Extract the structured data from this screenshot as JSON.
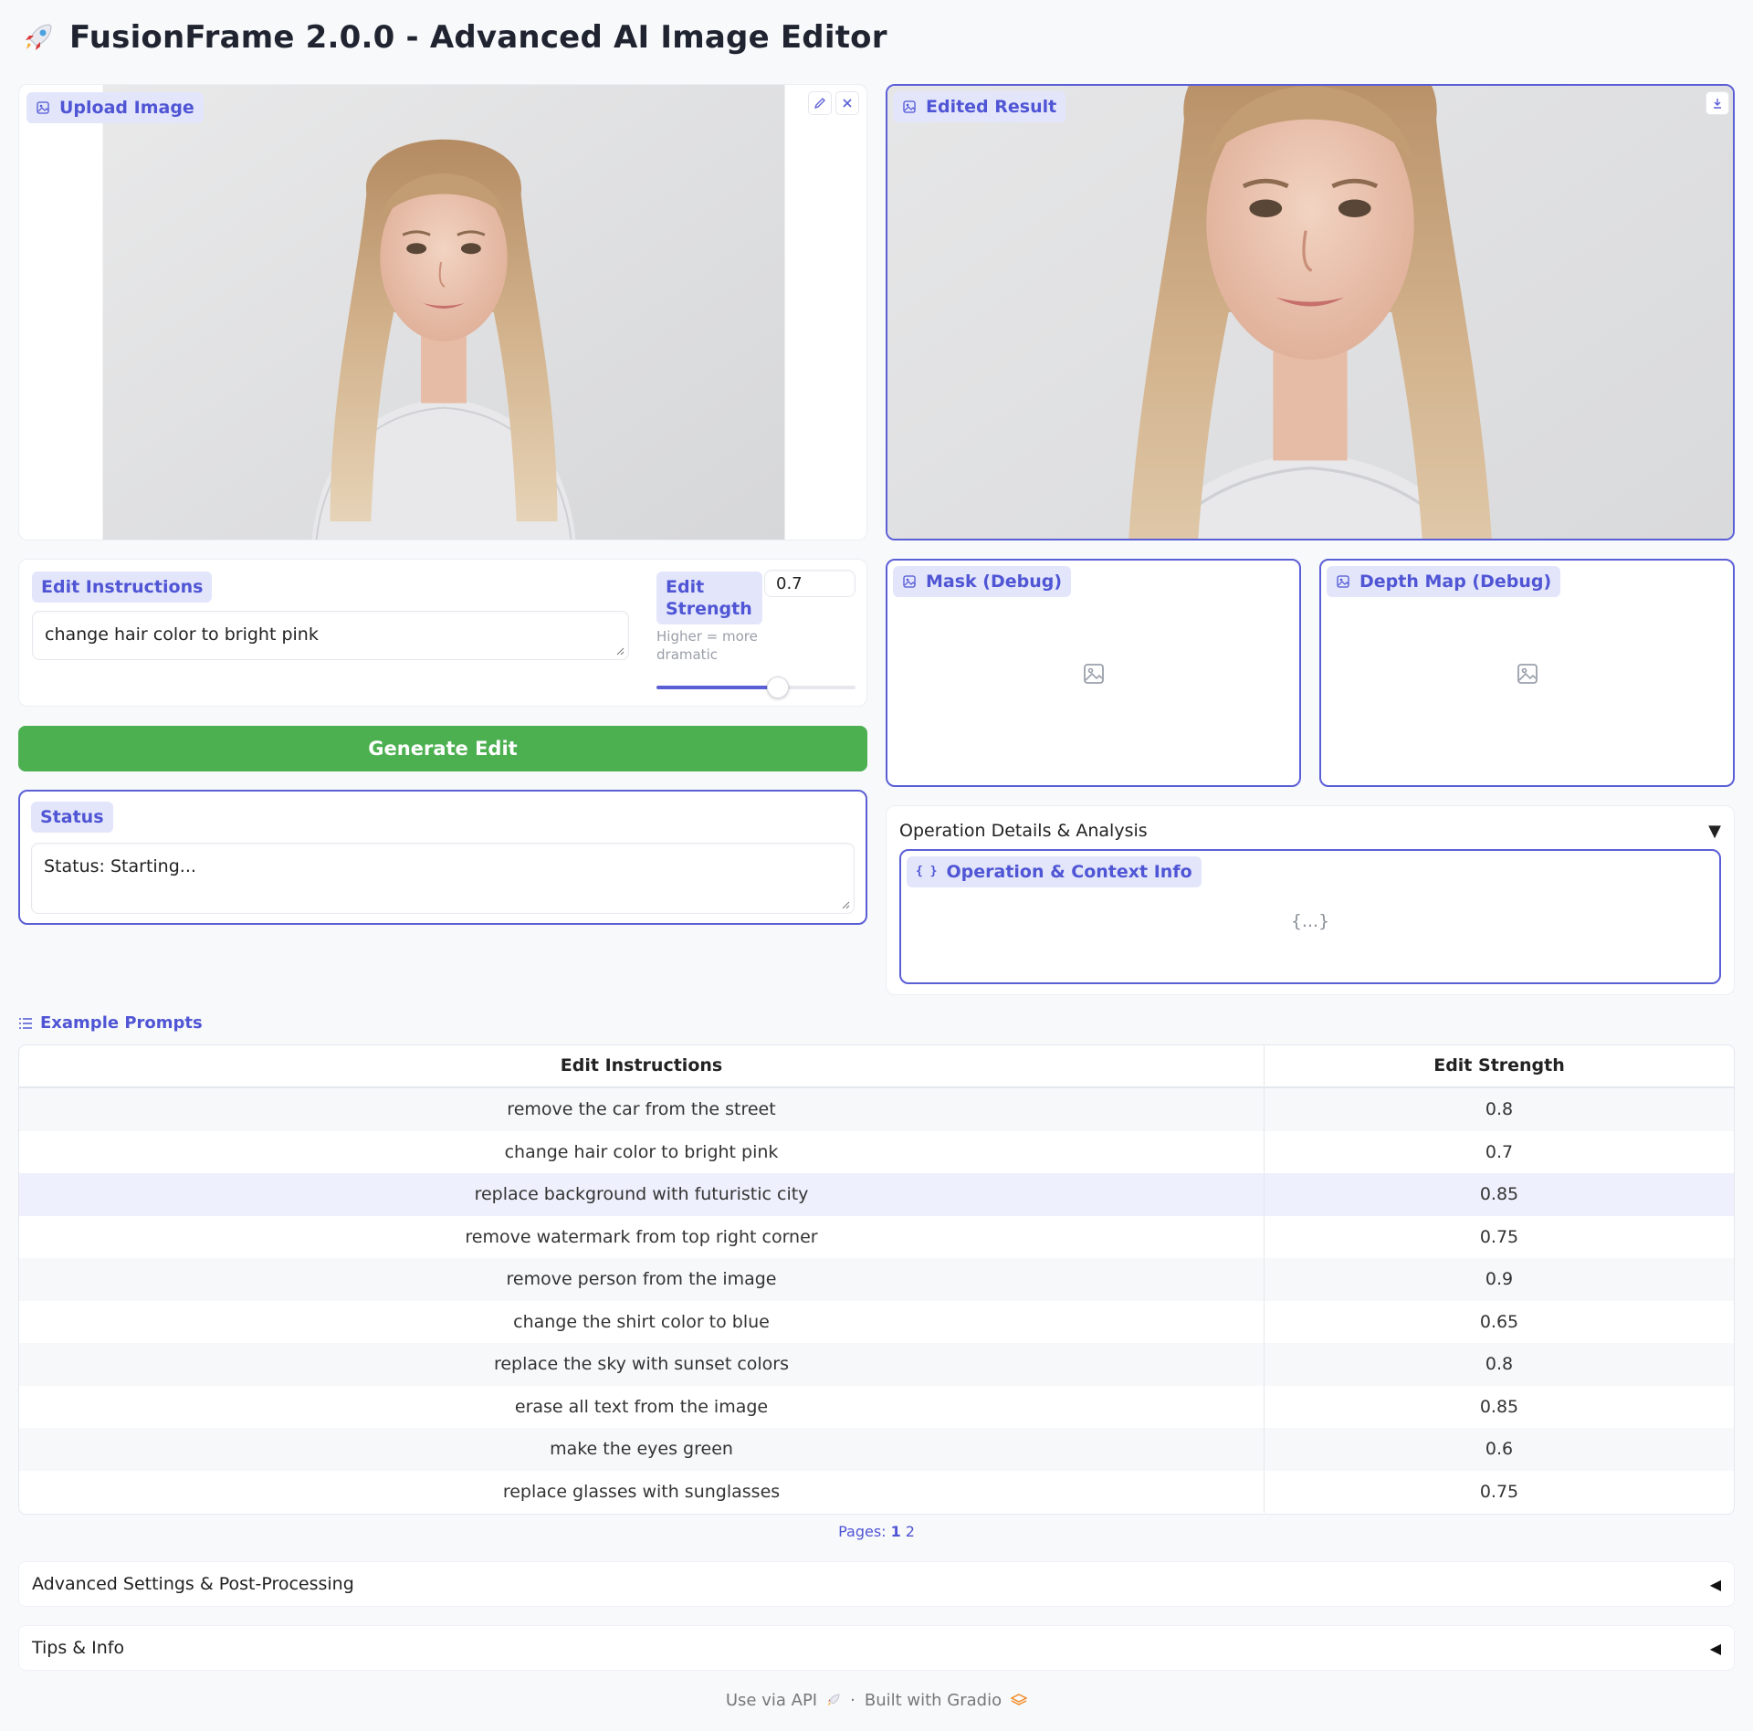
{
  "header": {
    "title": "FusionFrame 2.0.0 - Advanced AI Image Editor",
    "icon": "rocket-icon"
  },
  "upload": {
    "label": "Upload Image"
  },
  "result": {
    "label": "Edited Result"
  },
  "instructions": {
    "label": "Edit Instructions",
    "value": "change hair color to bright pink"
  },
  "strength": {
    "label_line1": "Edit",
    "label_line2": "Strength",
    "value": "0.7",
    "info_line1": "Higher = more",
    "info_line2": "dramatic",
    "level": 0.7
  },
  "generate": {
    "label": "Generate Edit"
  },
  "status": {
    "label": "Status",
    "value": "Status: Starting..."
  },
  "mask": {
    "label": "Mask (Debug)"
  },
  "depth": {
    "label": "Depth Map (Debug)"
  },
  "operation": {
    "accordion_label": "Operation Details & Analysis",
    "json_label": "Operation & Context Info",
    "json_placeholder": "{...}"
  },
  "examples": {
    "label": "Example Prompts",
    "headers": [
      "Edit Instructions",
      "Edit Strength"
    ],
    "rows": [
      [
        "remove the car from the street",
        "0.8"
      ],
      [
        "change hair color to bright pink",
        "0.7"
      ],
      [
        "replace background with futuristic city",
        "0.85"
      ],
      [
        "remove watermark from top right corner",
        "0.75"
      ],
      [
        "remove person from the image",
        "0.9"
      ],
      [
        "change the shirt color to blue",
        "0.65"
      ],
      [
        "replace the sky with sunset colors",
        "0.8"
      ],
      [
        "erase all text from the image",
        "0.85"
      ],
      [
        "make the eyes green",
        "0.6"
      ],
      [
        "replace glasses with sunglasses",
        "0.75"
      ]
    ],
    "pages_label": "Pages:",
    "page1": "1",
    "page2": "2"
  },
  "advanced": {
    "label": "Advanced Settings & Post-Processing"
  },
  "tips": {
    "label": "Tips & Info"
  },
  "footer": {
    "api": "Use via API",
    "sep": "·",
    "built": "Built with Gradio"
  },
  "colors": {
    "accent": "#5b5fd6",
    "button": "#4caf50",
    "chip_bg": "#e3e6fb"
  }
}
